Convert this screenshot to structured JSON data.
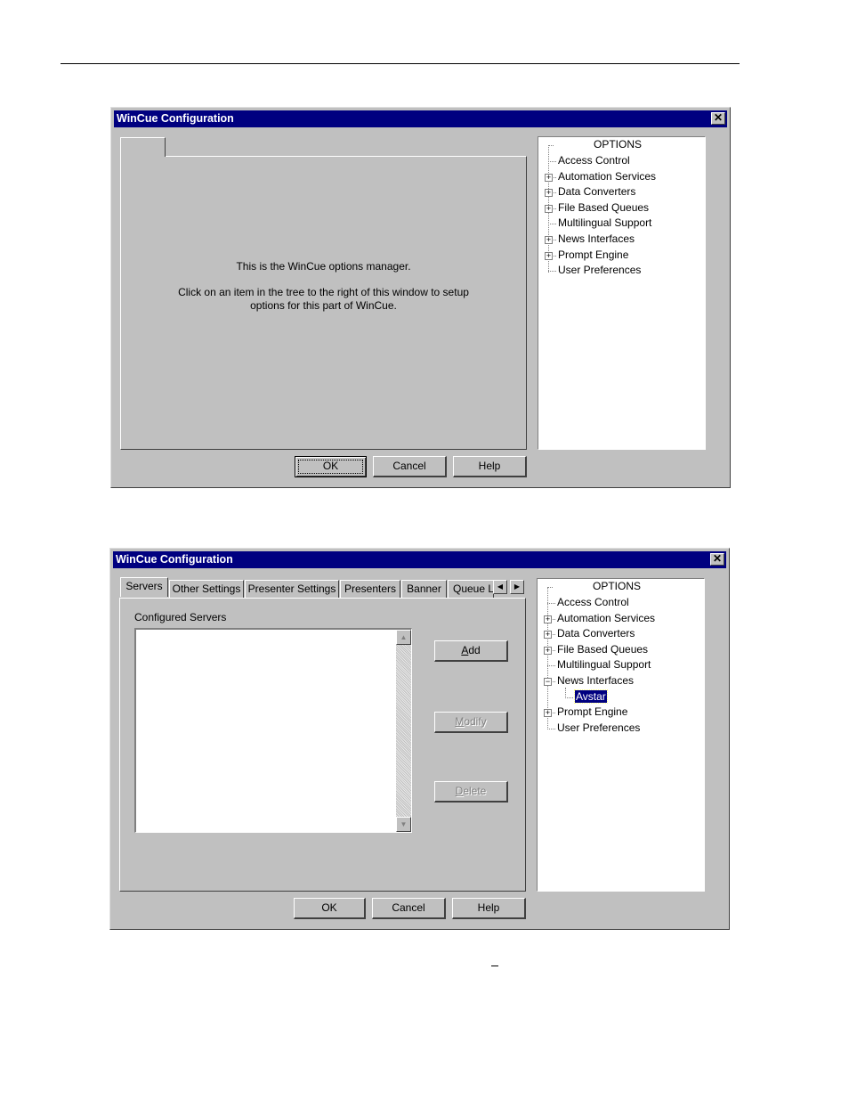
{
  "window1": {
    "title": "WinCue Configuration",
    "close": "✕",
    "message_line1": "This is the WinCue options manager.",
    "message_line2": "Click on an item in the tree to the right of this window to setup",
    "message_line3": "options for this part of WinCue.",
    "tree_root": "OPTIONS",
    "tree_items": [
      {
        "label": "Access Control",
        "expander": ""
      },
      {
        "label": "Automation Services",
        "expander": "+"
      },
      {
        "label": "Data Converters",
        "expander": "+"
      },
      {
        "label": "File Based Queues",
        "expander": "+"
      },
      {
        "label": "Multilingual Support",
        "expander": ""
      },
      {
        "label": "News Interfaces",
        "expander": "+"
      },
      {
        "label": "Prompt Engine",
        "expander": "+"
      },
      {
        "label": "User Preferences",
        "expander": ""
      }
    ],
    "ok": "OK",
    "cancel": "Cancel",
    "help": "Help"
  },
  "window2": {
    "title": "WinCue Configuration",
    "close": "✕",
    "tabs": [
      "Servers",
      "Other Settings",
      "Presenter Settings",
      "Presenters",
      "Banner",
      "Queue L"
    ],
    "tab_scroll_left": "◀",
    "tab_scroll_right": "▶",
    "configured_servers_label": "Configured Servers",
    "add_access": "A",
    "add_rest": "dd",
    "modify_access": "M",
    "modify_rest": "odify",
    "delete_access": "D",
    "delete_rest": "elete",
    "scroll_up": "▲",
    "scroll_down": "▼",
    "tree_root": "OPTIONS",
    "tree_items": [
      {
        "label": "Access Control",
        "expander": ""
      },
      {
        "label": "Automation Services",
        "expander": "+"
      },
      {
        "label": "Data Converters",
        "expander": "+"
      },
      {
        "label": "File Based Queues",
        "expander": "+"
      },
      {
        "label": "Multilingual Support",
        "expander": ""
      },
      {
        "label": "News Interfaces",
        "expander": "−"
      },
      {
        "label": "Avstar",
        "expander": "",
        "selected": true
      },
      {
        "label": "Prompt Engine",
        "expander": "+"
      },
      {
        "label": "User Preferences",
        "expander": ""
      }
    ],
    "ok": "OK",
    "cancel": "Cancel",
    "help": "Help"
  }
}
